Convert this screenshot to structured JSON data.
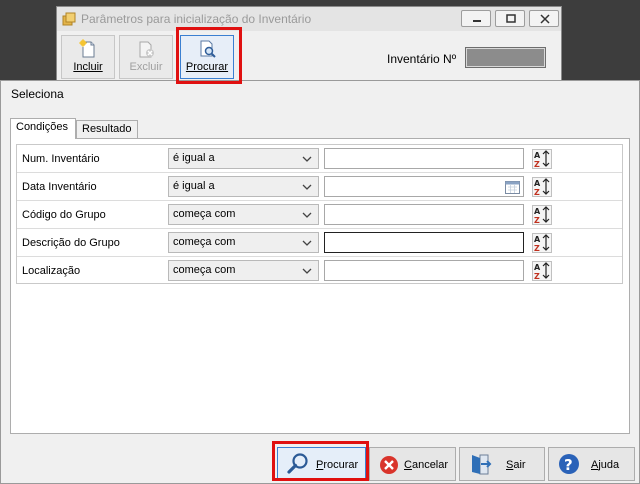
{
  "parent_window": {
    "title": "Parâmetros para inicialização do Inventário",
    "toolbar": {
      "incluir_label": "Incluir",
      "excluir_label": "Excluir",
      "procurar_label": "Procurar"
    },
    "inventario_label": "Inventário Nº",
    "inventario_value": ""
  },
  "dialog": {
    "title": "Seleciona",
    "tabs": [
      "Condições",
      "Resultado"
    ],
    "conditions": [
      {
        "label": "Num. Inventário",
        "operator": "é igual a",
        "value": ""
      },
      {
        "label": "Data Inventário",
        "operator": "é igual a",
        "value": ""
      },
      {
        "label": "Código do Grupo",
        "operator": "começa com",
        "value": ""
      },
      {
        "label": "Descrição do Grupo",
        "operator": "começa com",
        "value": ""
      },
      {
        "label": "Localização",
        "operator": "começa com",
        "value": ""
      }
    ],
    "buttons": {
      "procurar": {
        "accel": "P",
        "rest": "rocurar"
      },
      "cancelar": {
        "accel": "C",
        "rest": "ancelar"
      },
      "sair": {
        "accel": "S",
        "rest": "air"
      },
      "ajuda": {
        "accel": "A",
        "rest": "juda"
      }
    }
  },
  "colors": {
    "highlight": "#e01010",
    "focus_border": "#3b7fd1",
    "cancel_red": "#d9342b",
    "help_blue": "#2a62b8",
    "exit_blue": "#2f6fb7"
  }
}
